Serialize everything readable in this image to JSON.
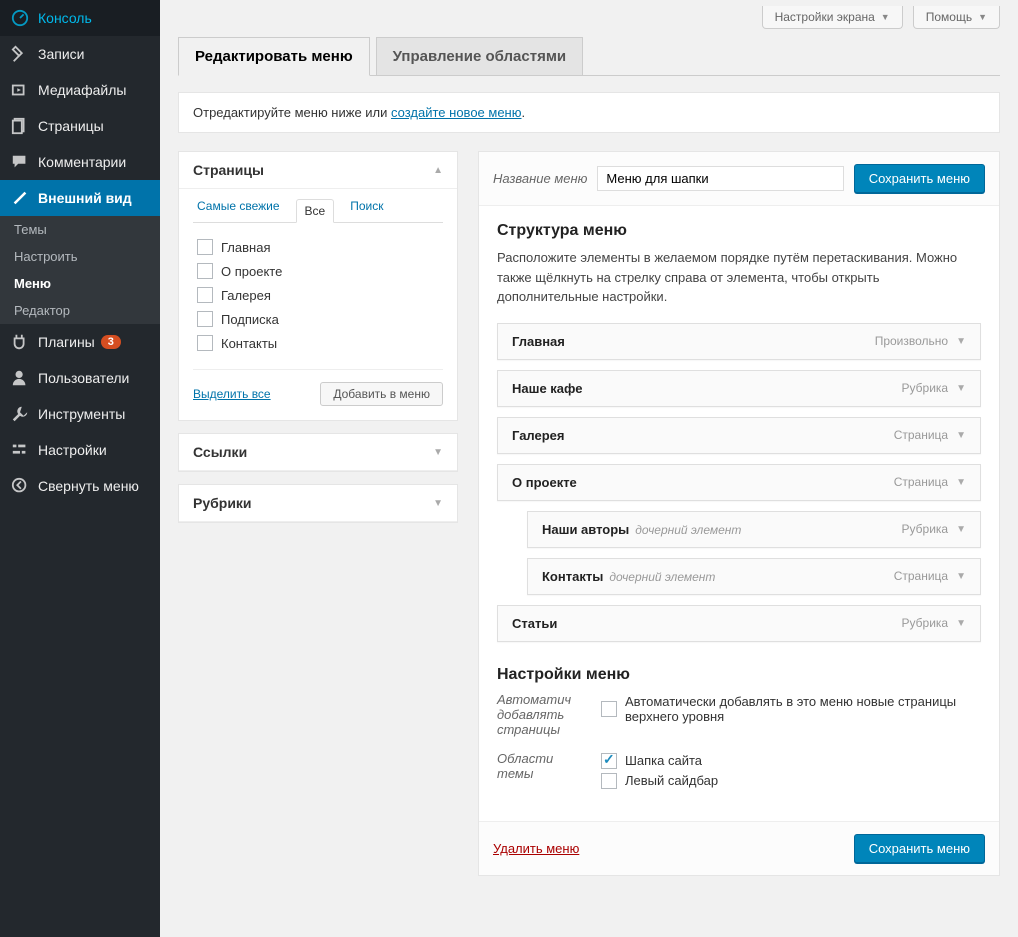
{
  "screen": {
    "options": "Настройки экрана",
    "help": "Помощь"
  },
  "sidebar": {
    "items": [
      {
        "label": "Консоль",
        "icon": "dashboard"
      },
      {
        "label": "Записи",
        "icon": "pin"
      },
      {
        "label": "Медиафайлы",
        "icon": "media"
      },
      {
        "label": "Страницы",
        "icon": "pages"
      },
      {
        "label": "Комментарии",
        "icon": "comment"
      },
      {
        "label": "Внешний вид",
        "icon": "appearance",
        "active": true
      },
      {
        "label": "Плагины",
        "icon": "plugin",
        "badge": "3"
      },
      {
        "label": "Пользователи",
        "icon": "users"
      },
      {
        "label": "Инструменты",
        "icon": "tools"
      },
      {
        "label": "Настройки",
        "icon": "settings"
      },
      {
        "label": "Свернуть меню",
        "icon": "collapse"
      }
    ],
    "submenu": [
      {
        "label": "Темы"
      },
      {
        "label": "Настроить"
      },
      {
        "label": "Меню",
        "current": true
      },
      {
        "label": "Редактор"
      }
    ]
  },
  "tabs": {
    "edit": "Редактировать меню",
    "manage": "Управление областями"
  },
  "notice": {
    "prefix": "Отредактируйте меню ниже или ",
    "link": "создайте новое меню",
    "suffix": "."
  },
  "pagesBox": {
    "title": "Страницы",
    "tabs": {
      "recent": "Самые свежие",
      "all": "Все",
      "search": "Поиск"
    },
    "items": [
      "Главная",
      "О проекте",
      "Галерея",
      "Подписка",
      "Контакты"
    ],
    "selectAll": "Выделить все",
    "addBtn": "Добавить в меню"
  },
  "linksBox": {
    "title": "Ссылки"
  },
  "catsBox": {
    "title": "Рубрики"
  },
  "menu": {
    "nameLabel": "Название меню",
    "nameValue": "Меню для шапки",
    "saveBtn": "Сохранить меню",
    "structTitle": "Структура меню",
    "structDesc": "Расположите элементы в желаемом порядке путём перетаскивания. Можно также щёлкнуть на стрелку справа от элемента, чтобы открыть дополнительные настройки.",
    "items": [
      {
        "title": "Главная",
        "type": "Произвольно",
        "indent": 0
      },
      {
        "title": "Наше кафе",
        "type": "Рубрика",
        "indent": 0
      },
      {
        "title": "Галерея",
        "type": "Страница",
        "indent": 0
      },
      {
        "title": "О проекте",
        "type": "Страница",
        "indent": 0
      },
      {
        "title": "Наши авторы",
        "type": "Рубрика",
        "indent": 1,
        "sub": "дочерний элемент"
      },
      {
        "title": "Контакты",
        "type": "Страница",
        "indent": 1,
        "sub": "дочерний элемент"
      },
      {
        "title": "Статьи",
        "type": "Рубрика",
        "indent": 0
      }
    ],
    "settingsTitle": "Настройки меню",
    "autoLabel": "Автоматич добавлять страницы",
    "autoOption": "Автоматически добавлять в это меню новые страницы верхнего уровня",
    "locLabel": "Области темы",
    "locations": [
      {
        "label": "Шапка сайта",
        "checked": true
      },
      {
        "label": "Левый сайдбар",
        "checked": false
      }
    ],
    "deleteLink": "Удалить меню"
  }
}
